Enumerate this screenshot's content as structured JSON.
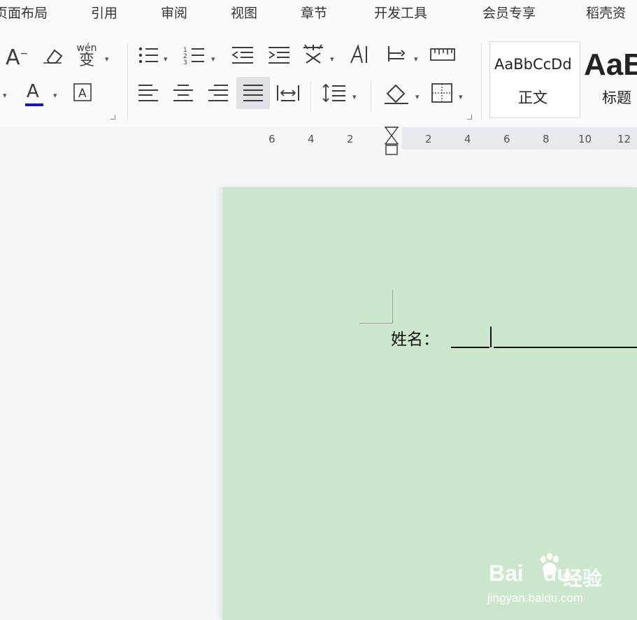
{
  "menu": {
    "items": [
      "页面布局",
      "引用",
      "审阅",
      "视图",
      "章节",
      "开发工具",
      "会员专享",
      "稻壳资"
    ]
  },
  "toolbar": {
    "font_color_label": "A",
    "phonetic_label": "wén",
    "phonetic_char": "变",
    "grow_font": "A",
    "char_border": "A"
  },
  "styles": {
    "body_sample": "AaBbCcDd",
    "body_name": "正文",
    "heading_sample": "AaB",
    "heading_name": "标题"
  },
  "ruler": {
    "numbers": [
      "6",
      "4",
      "2",
      "2",
      "4",
      "6",
      "8",
      "10",
      "12"
    ]
  },
  "document": {
    "name_label": "姓名：",
    "page_color": "#cbe8cf"
  },
  "watermark": {
    "logo": "Bai",
    "logo_tail": "du",
    "cn": "经验",
    "url": "jingyan.baidu.com"
  },
  "colors": {
    "font_color_bar": "#1a1aa8",
    "accent": "#e7ebf0"
  }
}
